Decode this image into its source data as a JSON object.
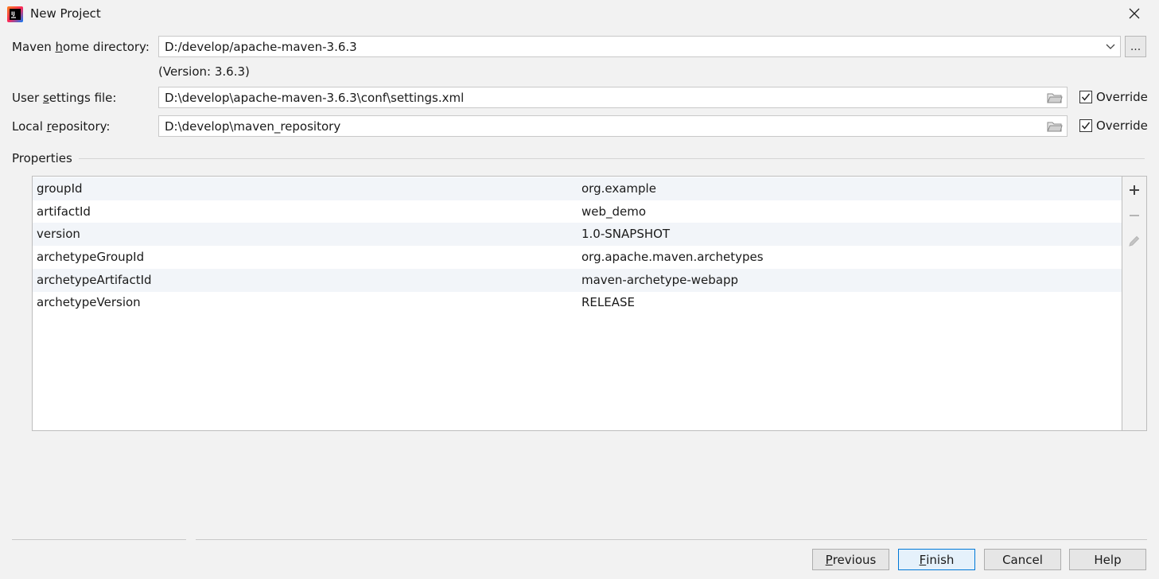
{
  "window": {
    "title": "New Project",
    "logo_icon": "intellij-logo-icon",
    "close_icon": "close-icon"
  },
  "maven": {
    "home_label_pre": "Maven ",
    "home_label_mnemonic": "h",
    "home_label_post": "ome directory:",
    "home_value": "D:/develop/apache-maven-3.6.3",
    "version_note": "(Version: 3.6.3)",
    "browse_label": "...",
    "settings_label_pre": "User ",
    "settings_label_mnemonic": "s",
    "settings_label_post": "ettings file:",
    "settings_value": "D:\\develop\\apache-maven-3.6.3\\conf\\settings.xml",
    "settings_override": "Override",
    "repo_label_pre": "Local ",
    "repo_label_mnemonic": "r",
    "repo_label_post": "epository:",
    "repo_value": "D:\\develop\\maven_repository",
    "repo_override": "Override"
  },
  "properties": {
    "section_title": "Properties",
    "rows": [
      {
        "key": "groupId",
        "value": "org.example"
      },
      {
        "key": "artifactId",
        "value": "web_demo"
      },
      {
        "key": "version",
        "value": "1.0-SNAPSHOT"
      },
      {
        "key": "archetypeGroupId",
        "value": "org.apache.maven.archetypes"
      },
      {
        "key": "archetypeArtifactId",
        "value": "maven-archetype-webapp"
      },
      {
        "key": "archetypeVersion",
        "value": "RELEASE"
      }
    ],
    "toolbar": [
      "add-icon",
      "remove-icon",
      "edit-icon"
    ]
  },
  "footer": {
    "previous_mnemonic": "P",
    "previous_rest": "revious",
    "finish_mnemonic": "F",
    "finish_rest": "inish",
    "cancel": "Cancel",
    "help": "Help"
  },
  "colors": {
    "background": "#f2f2f2",
    "accent_border": "#0078d7",
    "primary_button_bg": "#e5f1fb"
  }
}
